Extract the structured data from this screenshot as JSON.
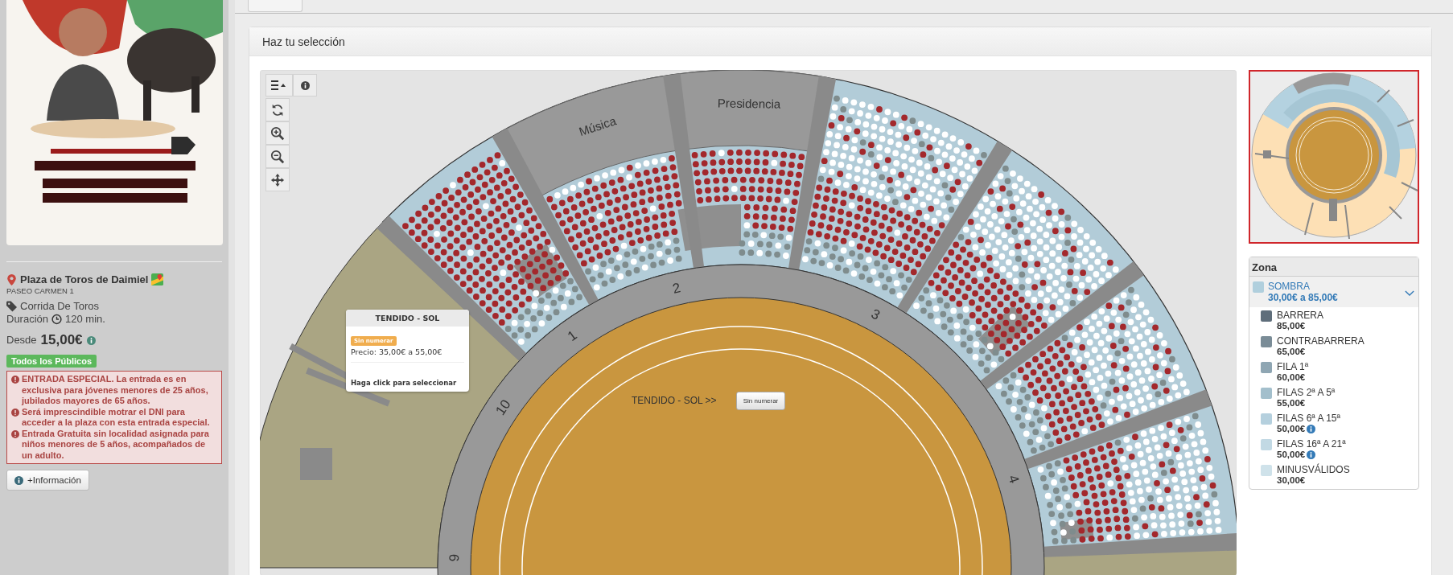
{
  "event": {
    "venue": "Plaza de Toros de Daimiel",
    "address": "PASEO CARMEN 1",
    "type": "Corrida De Toros",
    "duration_label": "Duración",
    "duration": "120 min.",
    "price_from_label": "Desde",
    "price_from": "15,00€",
    "audience": "Todos los Públicos",
    "notices": [
      "ENTRADA ESPECIAL. La entrada es en exclusiva para jóvenes menores de 25 años, jubilados mayores de 65 años.",
      "Será imprescindible motrar el DNI para acceder a la plaza con esta entrada especial.",
      "Entrada Gratuita sin localidad asignada para niños menores de 5 años, acompañados de un adulto."
    ],
    "info_button": "+Información"
  },
  "panel": {
    "title": "Haz tu selección"
  },
  "map": {
    "stand_labels": [
      "Música",
      "Presidencia"
    ],
    "sector_numbers": [
      "9",
      "10",
      "1",
      "2",
      "3",
      "4"
    ],
    "tooltip": {
      "title": "TENDIDO - SOL",
      "badge": "Sin numerar",
      "price": "Precio: 35,00€ a 55,00€",
      "hint": "Haga click para seleccionar"
    },
    "zone_label": {
      "text": "TENDIDO - SOL >>",
      "button": "Sin numerar"
    }
  },
  "zona": {
    "title": "Zona",
    "group": {
      "name": "SOMBRA",
      "price": "30,00€ a 85,00€",
      "color": "#b0cfdd",
      "expanded": true
    },
    "items": [
      {
        "name": "BARRERA",
        "price": "85,00€",
        "color": "#5f6e7b",
        "info": false
      },
      {
        "name": "CONTRABARRERA",
        "price": "65,00€",
        "color": "#7a8c97",
        "info": false
      },
      {
        "name": "FILA 1ª",
        "price": "60,00€",
        "color": "#8fa6b3",
        "info": false
      },
      {
        "name": "FILAS 2ª A 5ª",
        "price": "55,00€",
        "color": "#a3bfcc",
        "info": false
      },
      {
        "name": "FILAS 6ª A 15ª",
        "price": "50,00€",
        "color": "#b5d0de",
        "info": true
      },
      {
        "name": "FILAS 16ª A 21ª",
        "price": "50,00€",
        "color": "#c2d9e4",
        "info": true
      },
      {
        "name": "MINUSVÁLIDOS",
        "price": "30,00€",
        "color": "#cfe2ea",
        "info": false
      }
    ]
  }
}
